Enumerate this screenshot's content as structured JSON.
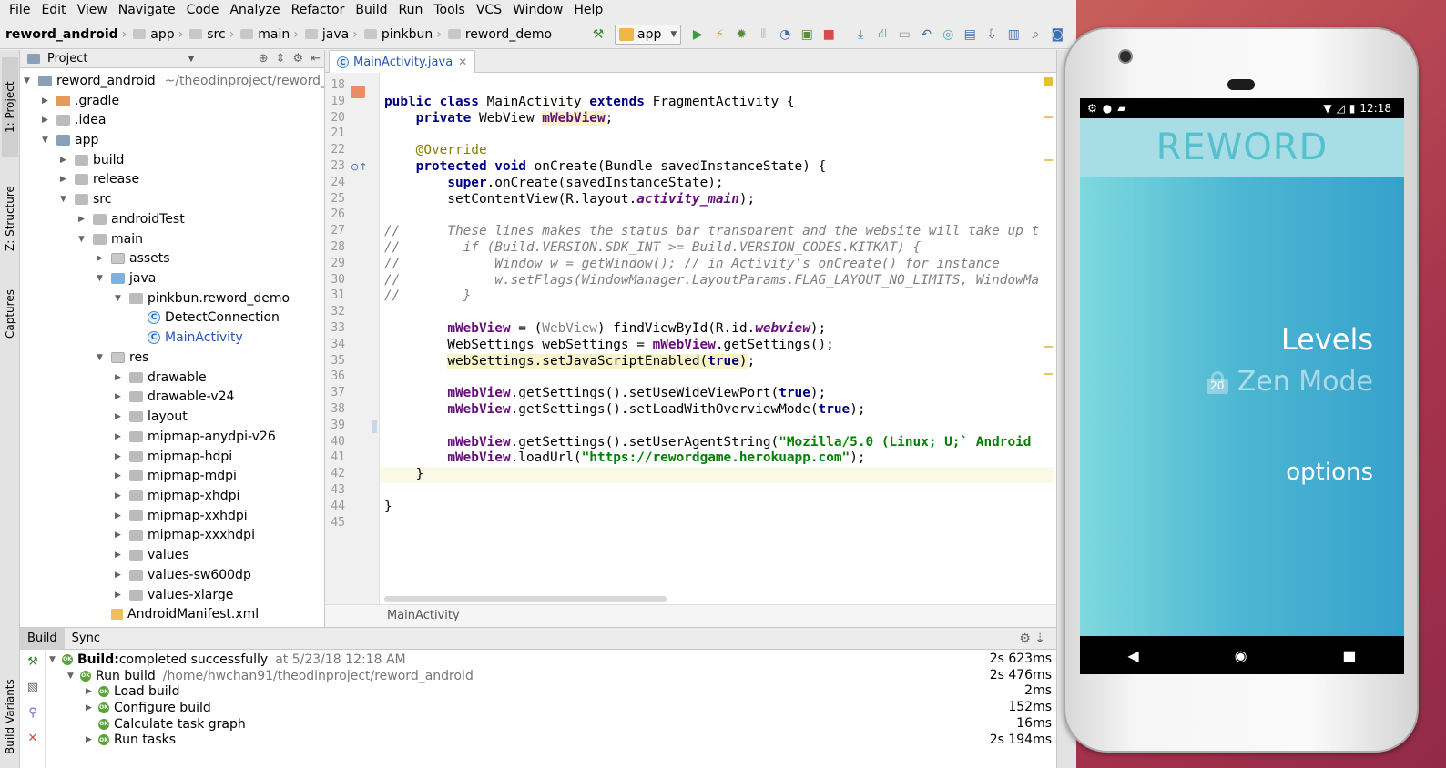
{
  "menu": [
    "File",
    "Edit",
    "View",
    "Navigate",
    "Code",
    "Analyze",
    "Refactor",
    "Build",
    "Run",
    "Tools",
    "VCS",
    "Window",
    "Help"
  ],
  "breadcrumbs": [
    "reword_android",
    "app",
    "src",
    "main",
    "java",
    "pinkbun",
    "reword_demo"
  ],
  "run_config": "app",
  "left_tool_tabs": [
    "1: Project",
    "Z: Structure",
    "Captures",
    "Build Variants"
  ],
  "project_panel": {
    "title": "Project",
    "root_name": "reword_android",
    "root_path": "~/theodinproject/reword_",
    "tree": [
      {
        "label": ".gradle",
        "depth": 1,
        "arrow": "right",
        "icon": "orange"
      },
      {
        "label": ".idea",
        "depth": 1,
        "arrow": "right",
        "icon": "grey"
      },
      {
        "label": "app",
        "depth": 1,
        "arrow": "down",
        "icon": "module"
      },
      {
        "label": "build",
        "depth": 2,
        "arrow": "right",
        "icon": "grey"
      },
      {
        "label": "release",
        "depth": 2,
        "arrow": "right",
        "icon": "grey"
      },
      {
        "label": "src",
        "depth": 2,
        "arrow": "down",
        "icon": "grey"
      },
      {
        "label": "androidTest",
        "depth": 3,
        "arrow": "right",
        "icon": "grey"
      },
      {
        "label": "main",
        "depth": 3,
        "arrow": "down",
        "icon": "grey"
      },
      {
        "label": "assets",
        "depth": 4,
        "arrow": "right",
        "icon": "res"
      },
      {
        "label": "java",
        "depth": 4,
        "arrow": "down",
        "icon": "blue"
      },
      {
        "label": "pinkbun.reword_demo",
        "depth": 5,
        "arrow": "down",
        "icon": "grey"
      },
      {
        "label": "DetectConnection",
        "depth": 6,
        "arrow": "",
        "icon": "class"
      },
      {
        "label": "MainActivity",
        "depth": 6,
        "arrow": "",
        "icon": "class",
        "selected": true
      },
      {
        "label": "res",
        "depth": 4,
        "arrow": "down",
        "icon": "res"
      },
      {
        "label": "drawable",
        "depth": 5,
        "arrow": "right",
        "icon": "grey"
      },
      {
        "label": "drawable-v24",
        "depth": 5,
        "arrow": "right",
        "icon": "grey"
      },
      {
        "label": "layout",
        "depth": 5,
        "arrow": "right",
        "icon": "grey"
      },
      {
        "label": "mipmap-anydpi-v26",
        "depth": 5,
        "arrow": "right",
        "icon": "grey"
      },
      {
        "label": "mipmap-hdpi",
        "depth": 5,
        "arrow": "right",
        "icon": "grey"
      },
      {
        "label": "mipmap-mdpi",
        "depth": 5,
        "arrow": "right",
        "icon": "grey"
      },
      {
        "label": "mipmap-xhdpi",
        "depth": 5,
        "arrow": "right",
        "icon": "grey"
      },
      {
        "label": "mipmap-xxhdpi",
        "depth": 5,
        "arrow": "right",
        "icon": "grey"
      },
      {
        "label": "mipmap-xxxhdpi",
        "depth": 5,
        "arrow": "right",
        "icon": "grey"
      },
      {
        "label": "values",
        "depth": 5,
        "arrow": "right",
        "icon": "grey"
      },
      {
        "label": "values-sw600dp",
        "depth": 5,
        "arrow": "right",
        "icon": "grey"
      },
      {
        "label": "values-xlarge",
        "depth": 5,
        "arrow": "right",
        "icon": "grey"
      },
      {
        "label": "AndroidManifest.xml",
        "depth": 4,
        "arrow": "",
        "icon": "manifest"
      }
    ]
  },
  "editor": {
    "tab_label": "MainActivity.java",
    "bottom_breadcrumb": "MainActivity",
    "current_line": 42,
    "lines": [
      {
        "n": 18,
        "html": ""
      },
      {
        "n": 19,
        "html": "<span class=\"kw\">public class</span> MainActivity <span class=\"kw\">extends</span> FragmentActivity {"
      },
      {
        "n": 20,
        "html": "    <span class=\"kw\">private</span> WebView <span class=\"fld warn-bg\">mWebView</span>;"
      },
      {
        "n": 21,
        "html": ""
      },
      {
        "n": 22,
        "html": "    <span class=\"ann\">@Override</span>"
      },
      {
        "n": 23,
        "html": "    <span class=\"kw\">protected void</span> onCreate(Bundle savedInstanceState) {"
      },
      {
        "n": 24,
        "html": "        <span class=\"kw\">super</span>.onCreate(savedInstanceState);"
      },
      {
        "n": 25,
        "html": "        setContentView(R.layout.<span class=\"fld-i\">activity_main</span>);"
      },
      {
        "n": 26,
        "html": ""
      },
      {
        "n": 27,
        "html": "<span class=\"cmt\">//      These lines makes the status bar transparent and the website will take up t</span>"
      },
      {
        "n": 28,
        "html": "<span class=\"cmt\">//        if (Build.VERSION.SDK_INT &gt;= Build.VERSION_CODES.KITKAT) {</span>"
      },
      {
        "n": 29,
        "html": "<span class=\"cmt\">//            Window w = getWindow(); // in Activity's onCreate() for instance</span>"
      },
      {
        "n": 30,
        "html": "<span class=\"cmt\">//            w.setFlags(WindowManager.LayoutParams.FLAG_LAYOUT_NO_LIMITS, WindowMa</span>"
      },
      {
        "n": 31,
        "html": "<span class=\"cmt\">//        }</span>"
      },
      {
        "n": 32,
        "html": ""
      },
      {
        "n": 33,
        "html": "        <span class=\"fld\">mWebView</span> = (<span class=\"cast\">WebView</span>) findViewById(R.id.<span class=\"fld-i\">webview</span>);"
      },
      {
        "n": 34,
        "html": "        WebSettings webSettings = <span class=\"fld\">mWebView</span>.getSettings();"
      },
      {
        "n": 35,
        "html": "        <span class=\"warn-bg\">webSettings.setJavaScriptEnabled(<span class=\"kw\">true</span>)</span>;"
      },
      {
        "n": 36,
        "html": ""
      },
      {
        "n": 37,
        "html": "        <span class=\"fld\">mWebView</span>.getSettings().setUseWideViewPort(<span class=\"kw\">true</span>);"
      },
      {
        "n": 38,
        "html": "        <span class=\"fld\">mWebView</span>.getSettings().setLoadWithOverviewMode(<span class=\"kw\">true</span>);"
      },
      {
        "n": 39,
        "html": ""
      },
      {
        "n": 40,
        "html": "        <span class=\"fld\">mWebView</span>.getSettings().setUserAgentString(<span class=\"str\">\"Mozilla/5.0 (Linux; U;` Android</span>"
      },
      {
        "n": 41,
        "html": "        <span class=\"fld\">mWebView</span>.loadUrl(<span class=\"str\">\"https://rewordgame.herokuapp.com\"</span>);"
      },
      {
        "n": 42,
        "html": "    }"
      },
      {
        "n": 43,
        "html": ""
      },
      {
        "n": 44,
        "html": "}"
      },
      {
        "n": 45,
        "html": ""
      }
    ]
  },
  "build": {
    "tabs": [
      "Build",
      "Sync"
    ],
    "rows": [
      {
        "depth": 0,
        "arrow": "down",
        "label": "Build:",
        "label2": " completed successfully",
        "muted": "at 5/23/18 12:18 AM",
        "time": "2s 623ms",
        "bold": true
      },
      {
        "depth": 1,
        "arrow": "down",
        "label": "Run build",
        "label2": "",
        "muted": "/home/hwchan91/theodinproject/reword_android",
        "time": "2s 476ms"
      },
      {
        "depth": 2,
        "arrow": "right",
        "label": "Load build",
        "label2": "",
        "muted": "",
        "time": "2ms"
      },
      {
        "depth": 2,
        "arrow": "right",
        "label": "Configure build",
        "label2": "",
        "muted": "",
        "time": "152ms"
      },
      {
        "depth": 2,
        "arrow": "",
        "label": "Calculate task graph",
        "label2": "",
        "muted": "",
        "time": "16ms"
      },
      {
        "depth": 2,
        "arrow": "right",
        "label": "Run tasks",
        "label2": "",
        "muted": "",
        "time": "2s 194ms"
      }
    ]
  },
  "phone": {
    "time": "12:18",
    "app_title": "REWORD",
    "options": {
      "levels": "Levels",
      "zen_mode": "Zen Mode",
      "zen_lock_count": "20",
      "options": "options"
    }
  }
}
